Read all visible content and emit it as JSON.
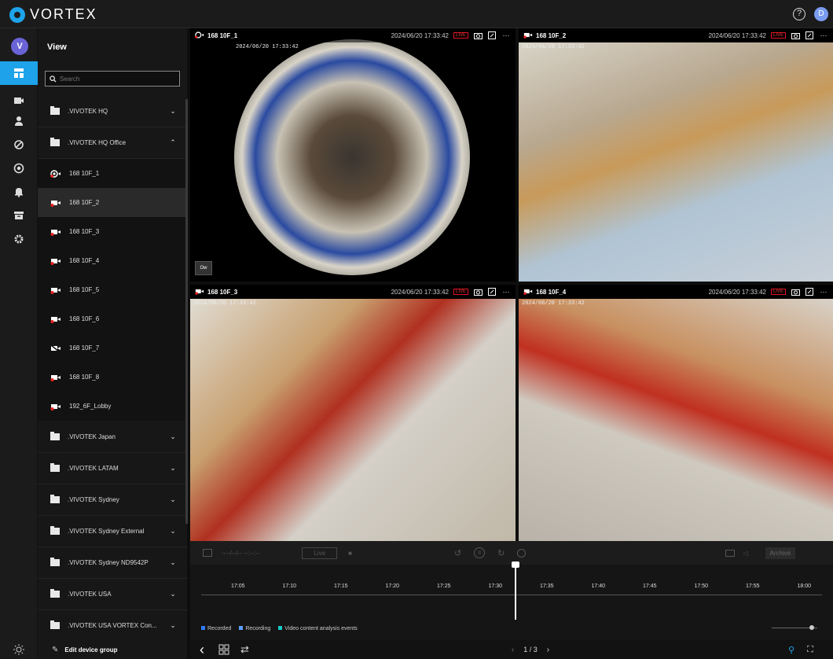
{
  "app": {
    "brand": "VORTEX",
    "user_initial": "D",
    "help_icon": "help-icon"
  },
  "rail": {
    "avatar": "V",
    "items": [
      "view-icon",
      "camera-icon",
      "person-icon",
      "tag-icon",
      "alert-circle-icon",
      "bell-icon",
      "archive-icon",
      "gear-icon"
    ],
    "accent": "#1ea3ea"
  },
  "panel": {
    "title": "View",
    "search_placeholder": "Search",
    "groups_top": [
      {
        "label": ".VIVOTEK HQ",
        "expanded": false
      },
      {
        "label": ".VIVOTEK HQ Office",
        "expanded": true
      }
    ],
    "cameras": [
      {
        "label": "168 10F_1",
        "selected": false
      },
      {
        "label": "168 10F_2",
        "selected": true
      },
      {
        "label": "168 10F_3",
        "selected": false
      },
      {
        "label": "168 10F_4",
        "selected": false
      },
      {
        "label": "168 10F_5",
        "selected": false
      },
      {
        "label": "168 10F_6",
        "selected": false
      },
      {
        "label": "168 10F_7",
        "selected": false
      },
      {
        "label": "168 10F_8",
        "selected": false
      },
      {
        "label": "192_6F_Lobby",
        "selected": false
      }
    ],
    "groups_bottom": [
      {
        "label": ".VIVOTEK Japan"
      },
      {
        "label": ".VIVOTEK LATAM"
      },
      {
        "label": ".VIVOTEK Sydney"
      },
      {
        "label": ".VIVOTEK Sydney External"
      },
      {
        "label": ".VIVOTEK Sydney ND9542P"
      },
      {
        "label": ".VIVOTEK USA"
      },
      {
        "label": ".VIVOTEK USA VORTEX Con..."
      }
    ],
    "footer": "Edit device group"
  },
  "tiles": [
    {
      "name": "168 10F_1",
      "timestamp": "2024/06/20 17:33:42",
      "osd": "2024/06/20 17:33:42",
      "badge": "LIVE",
      "corner_label": "Ow"
    },
    {
      "name": "168 10F_2",
      "timestamp": "2024/06/20 17:33:42",
      "osd": "2024/06/20 17:33:42",
      "badge": "LIVE"
    },
    {
      "name": "168 10F_3",
      "timestamp": "2024/06/20 17:33:42",
      "osd": "2024/06/20 17:33:42",
      "badge": "LIVE"
    },
    {
      "name": "168 10F_4",
      "timestamp": "2024/06/20 17:33:42",
      "osd": "2024/06/20 17:33:42",
      "badge": "LIVE"
    }
  ],
  "controls": {
    "date_placeholder": "----/--/-- --:--:--",
    "live_label": "Live",
    "archive_label": "Archive",
    "timeline_ticks": [
      "17:05",
      "17:10",
      "17:15",
      "17:20",
      "17:25",
      "17:30",
      "17:35",
      "17:40",
      "17:45",
      "17:50",
      "17:55",
      "18:00"
    ],
    "legend": [
      {
        "label": "Recorded",
        "color": "#2f7cf0"
      },
      {
        "label": "Recording",
        "color": "#5aa0ff"
      },
      {
        "label": "Video content analysis events",
        "color": "#19c8c8"
      }
    ]
  },
  "bottom": {
    "page": "1 / 3"
  }
}
